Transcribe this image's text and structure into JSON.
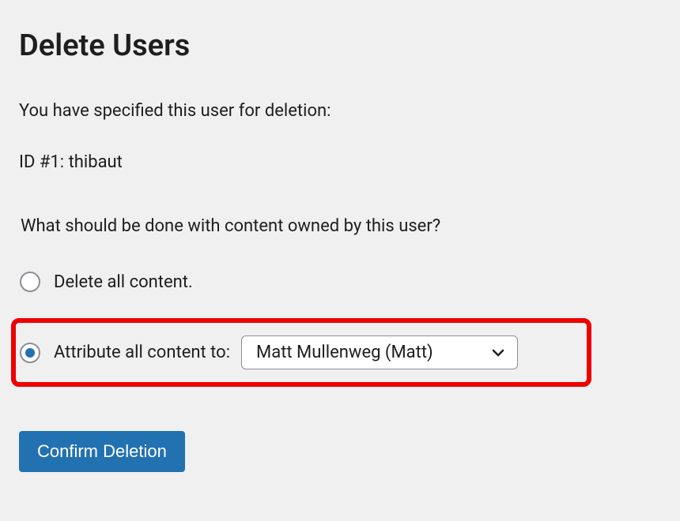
{
  "page_title": "Delete Users",
  "intro_text": "You have specified this user for deletion:",
  "user_line": "ID #1: thibaut",
  "question": "What should be done with content owned by this user?",
  "options": {
    "delete_all": {
      "label": "Delete all content.",
      "selected": false
    },
    "attribute_to": {
      "label": "Attribute all content to:",
      "selected": true,
      "dropdown_value": "Matt Mullenweg (Matt)"
    }
  },
  "confirm_button": "Confirm Deletion"
}
